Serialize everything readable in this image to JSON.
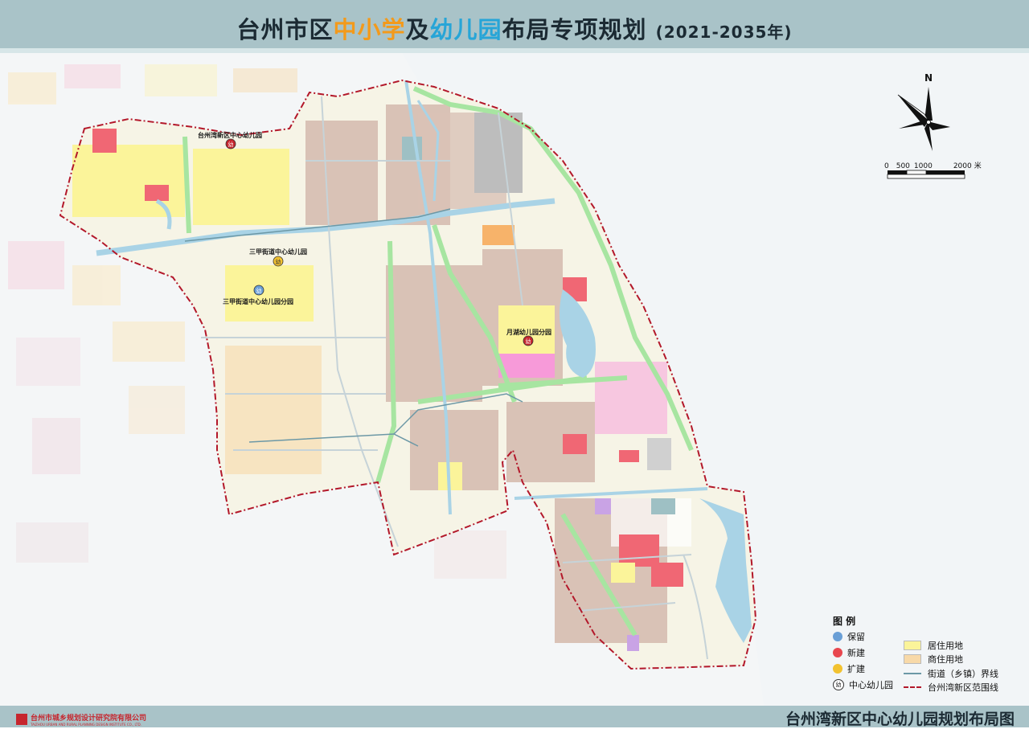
{
  "title": {
    "part1": "台州市区",
    "part2": "中小学",
    "part3": "及",
    "part4": "幼儿园",
    "part5": "布局",
    "part6": "专项规划",
    "years": "(2021-2035年)"
  },
  "map_title": "台州湾新区中心幼儿园规划布局图",
  "institute": {
    "name_cn": "台州市城乡规划设计研究院有限公司",
    "name_en": "TAIZHOU URBAN AND RURAL PLANNING DESIGN INSTITUTE CO., LTD."
  },
  "compass": {
    "label": "N"
  },
  "scale": {
    "ticks": [
      "0",
      "500",
      "1000",
      "2000"
    ],
    "unit": "米"
  },
  "kindergartens": [
    {
      "name": "台州湾新区中心幼儿园",
      "status": "新建"
    },
    {
      "name": "三甲街道中心幼儿园",
      "status": "扩建"
    },
    {
      "name": "三甲街道中心幼儿园分园",
      "status": "保留"
    },
    {
      "name": "月湖幼儿园分园",
      "status": "新建"
    }
  ],
  "kindergarten_glyph": "幼",
  "legend": {
    "title": "图 例",
    "retain": "保留",
    "new": "新建",
    "expand": "扩建",
    "center_kindergarten": "中心幼儿园",
    "residential": "居住用地",
    "commercial_residential": "商住用地",
    "street_boundary": "街道（乡镇）界线",
    "district_boundary": "台州湾新区范围线"
  },
  "colors": {
    "retain": "#6a9fd6",
    "new": "#e8474f",
    "expand": "#f2c230",
    "residential": "#fbf49a",
    "commercial_residential": "#f8d9a8",
    "boundary": "#b3182a",
    "water": "#a9d3e6",
    "green": "#a7e5a1"
  }
}
